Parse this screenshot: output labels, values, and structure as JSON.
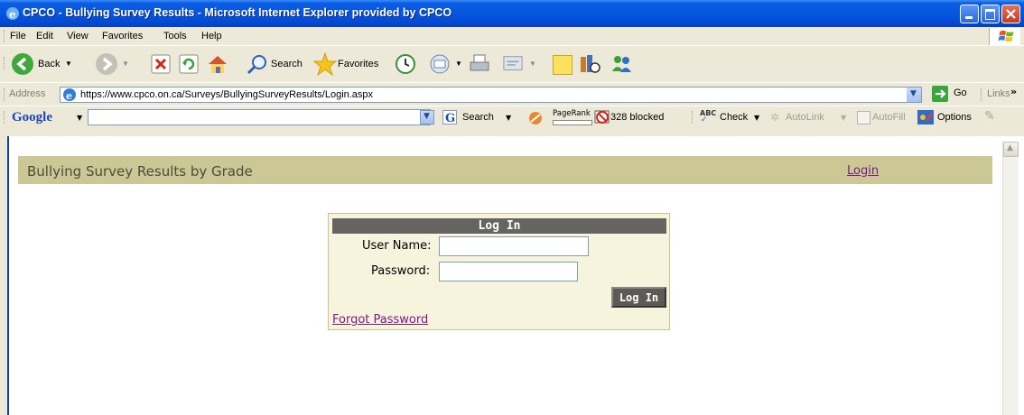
{
  "window": {
    "title": "CPCO - Bullying Survey Results - Microsoft Internet Explorer provided by CPCO"
  },
  "menu": [
    "File",
    "Edit",
    "View",
    "Favorites",
    "Tools",
    "Help"
  ],
  "toolbar": {
    "back_label": "Back",
    "search_label": "Search",
    "favorites_label": "Favorites"
  },
  "address": {
    "label": "Address",
    "url": "https://www.cpco.on.ca/Surveys/BullyingSurveyResults/Login.aspx",
    "go_label": "Go",
    "links_label": "Links"
  },
  "google": {
    "logo": "Google",
    "search_label": "Search",
    "pagerank_label": "PageRank",
    "blocked_label": "328 blocked",
    "check_label": "Check",
    "autolink_label": "AutoLink",
    "autofill_label": "AutoFill",
    "options_label": "Options"
  },
  "page": {
    "title": "Bullying Survey Results by Grade",
    "login_link": "Login"
  },
  "login": {
    "heading": "Log In",
    "username_label": "User Name:",
    "username_value": "",
    "password_label": "Password:",
    "password_value": "",
    "button_label": "Log In",
    "forgot_link": "Forgot Password"
  },
  "colors": {
    "titlebar": "#0556e0",
    "header_band": "#cbc895",
    "panel_bg": "#f6f4dd",
    "panel_head": "#666460",
    "link_visited": "#7b1b85"
  }
}
